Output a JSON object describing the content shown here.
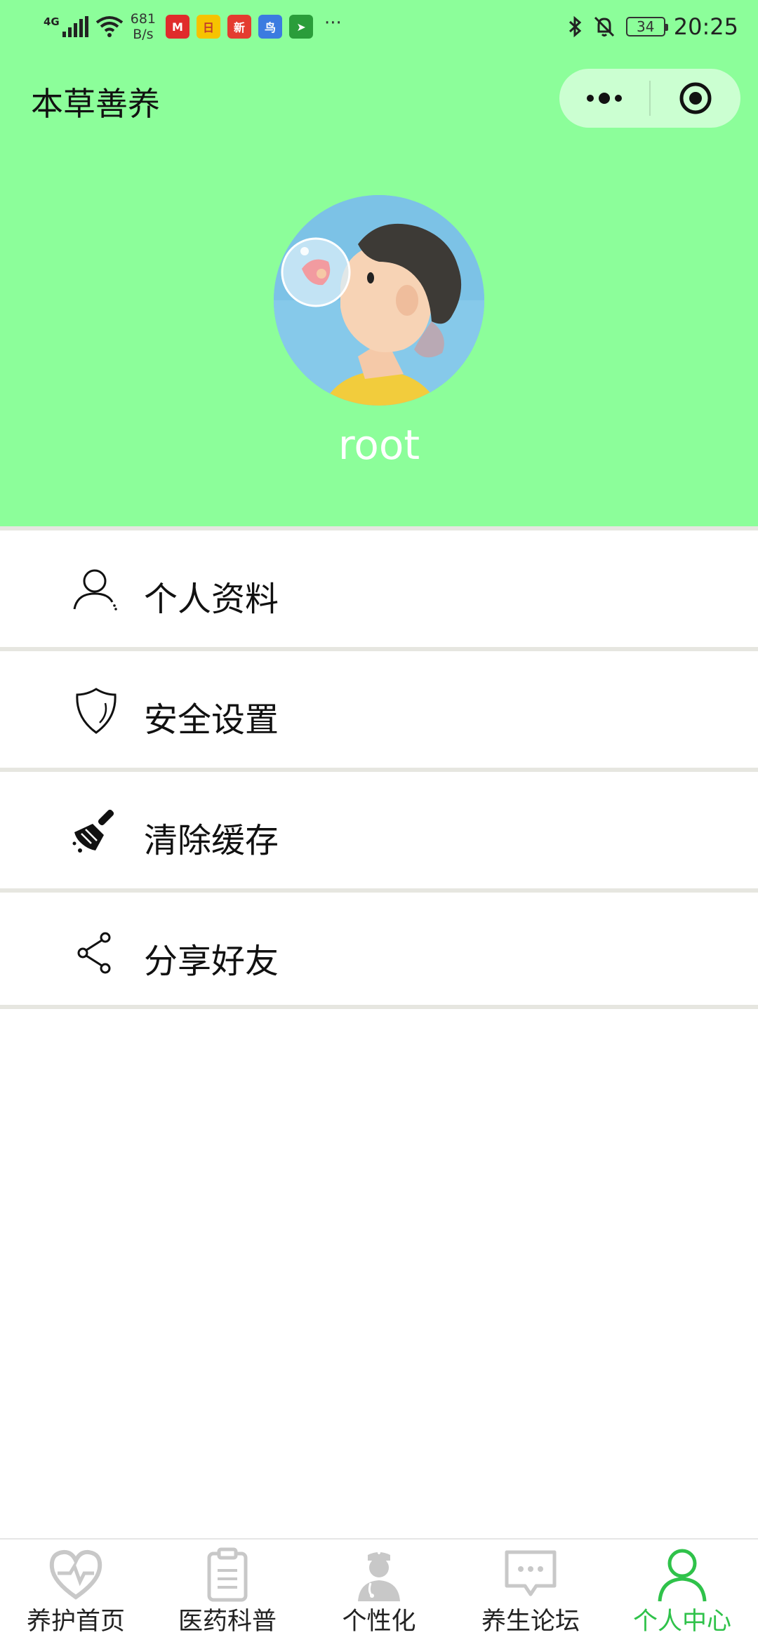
{
  "status_bar": {
    "network": "4G",
    "speed_value": "681",
    "speed_unit": "B/s",
    "app_icons": [
      "mall-app-icon",
      "calendar-app-icon",
      "news-app-icon",
      "bird-app-icon",
      "location-app-icon"
    ],
    "app_labels": [
      "M",
      "日",
      "新",
      "鸟",
      "➤"
    ],
    "app_colors": [
      "#e02b2b",
      "#f6c300",
      "#e43b2f",
      "#3b7be0",
      "#2a9d3a"
    ],
    "more": "···",
    "battery": "34",
    "time": "20:25"
  },
  "nav": {
    "title": "本草善养"
  },
  "profile": {
    "username": "root"
  },
  "menu": [
    {
      "label": "个人资料",
      "icon": "person-icon"
    },
    {
      "label": "安全设置",
      "icon": "shield-icon"
    },
    {
      "label": "清除缓存",
      "icon": "broom-icon"
    },
    {
      "label": "分享好友",
      "icon": "share-icon"
    }
  ],
  "tabbar": {
    "active_index": 4,
    "active_color": "#2fc24a",
    "items": [
      {
        "label": "养护首页",
        "icon": "heart-pulse-icon"
      },
      {
        "label": "医药科普",
        "icon": "clipboard-icon"
      },
      {
        "label": "个性化",
        "icon": "doctor-icon"
      },
      {
        "label": "养生论坛",
        "icon": "chat-bubble-icon"
      },
      {
        "label": "个人中心",
        "icon": "person-icon"
      }
    ]
  },
  "colors": {
    "header_bg": "#8cfe9a",
    "divider": "#e6e6e0"
  }
}
